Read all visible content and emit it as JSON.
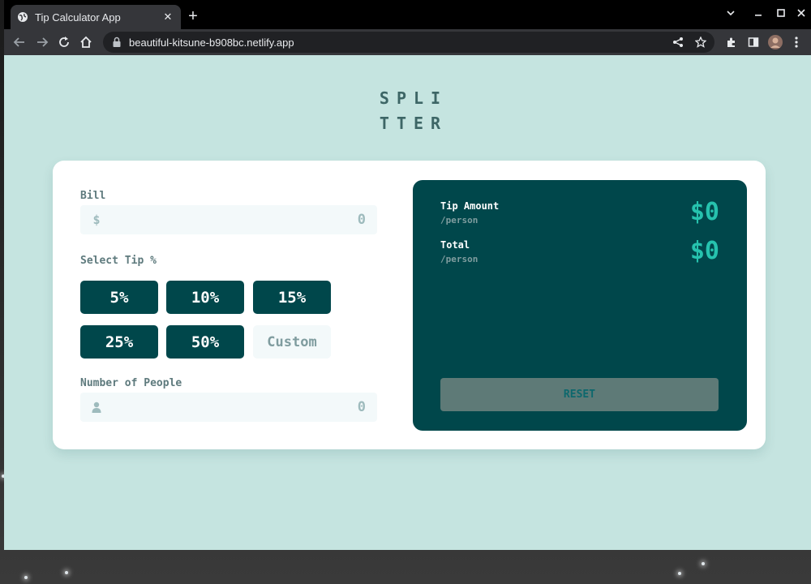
{
  "browser": {
    "tab_title": "Tip Calculator App",
    "url": "beautiful-kitsune-b908bc.netlify.app"
  },
  "app": {
    "logo_line1": "SPLI",
    "logo_line2": "TTER"
  },
  "form": {
    "bill_label": "Bill",
    "bill_placeholder": "0",
    "currency_symbol": "$",
    "select_tip_label": "Select Tip %",
    "tips": [
      "5%",
      "10%",
      "15%",
      "25%",
      "50%"
    ],
    "custom_placeholder": "Custom",
    "people_label": "Number of People",
    "people_placeholder": "0"
  },
  "results": {
    "tip_label": "Tip Amount",
    "tip_sub": "/person",
    "tip_value": "$0",
    "total_label": "Total",
    "total_sub": "/person",
    "total_value": "$0",
    "reset_label": "RESET"
  },
  "colors": {
    "primary": "#00474b",
    "accent": "#26c2ae",
    "page_bg": "#c5e4e0"
  },
  "icons": {
    "tab_favicon": "globe-icon",
    "lock": "lock-icon",
    "person": "person-icon"
  }
}
